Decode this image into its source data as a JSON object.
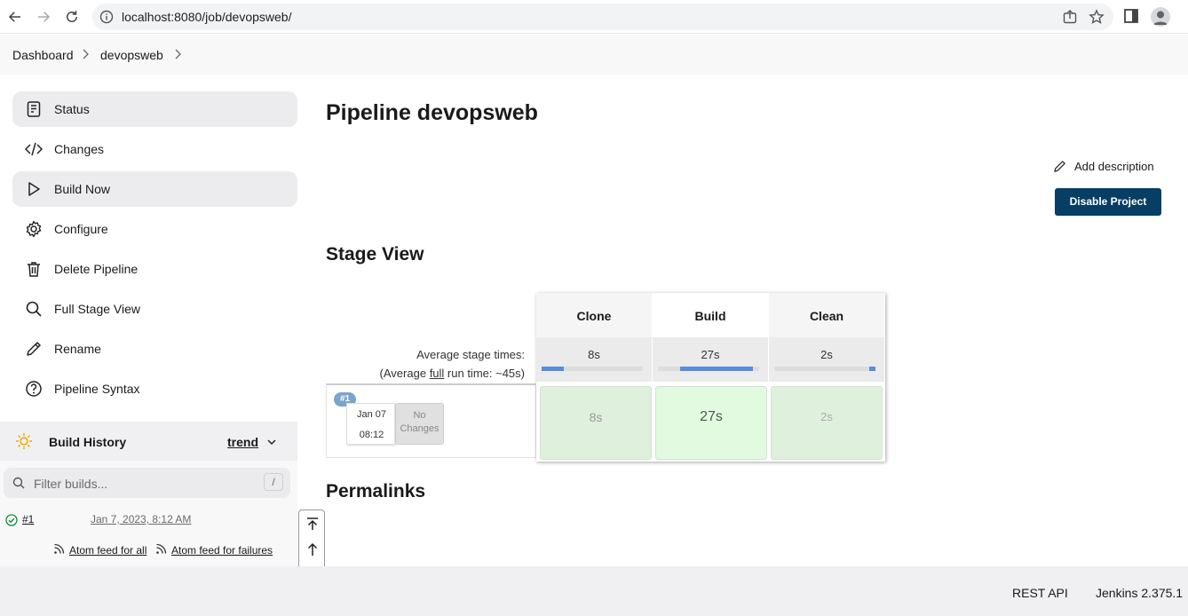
{
  "browser": {
    "url": "localhost:8080/job/devopsweb/"
  },
  "breadcrumb": {
    "items": [
      "Dashboard",
      "devopsweb"
    ]
  },
  "sidebar": {
    "items": [
      {
        "label": "Status",
        "icon": "status-icon"
      },
      {
        "label": "Changes",
        "icon": "code-icon"
      },
      {
        "label": "Build Now",
        "icon": "play-icon"
      },
      {
        "label": "Configure",
        "icon": "gear-icon"
      },
      {
        "label": "Delete Pipeline",
        "icon": "trash-icon"
      },
      {
        "label": "Full Stage View",
        "icon": "search-icon"
      },
      {
        "label": "Rename",
        "icon": "pencil-icon"
      },
      {
        "label": "Pipeline Syntax",
        "icon": "help-icon"
      }
    ]
  },
  "build_history": {
    "title": "Build History",
    "trend": "trend",
    "filter_placeholder": "Filter builds...",
    "filter_shortcut": "/",
    "builds": [
      {
        "number": "#1",
        "date": "Jan 7, 2023, 8:12 AM",
        "status": "success"
      }
    ],
    "feed_all": "Atom feed for all",
    "feed_failures": "Atom feed for failures"
  },
  "main": {
    "title": "Pipeline devopsweb",
    "add_description": "Add description",
    "disable_button": "Disable Project",
    "stage_view_title": "Stage View",
    "permalinks_title": "Permalinks"
  },
  "stage_view": {
    "avg_label": "Average stage times:",
    "avg_full_prefix": "(Average ",
    "avg_full_link": "full",
    "avg_full_suffix": " run time: ~45s)",
    "stages": [
      {
        "name": "Clone",
        "avg": "8s",
        "bar_fill": [
          0.0,
          0.22
        ],
        "run_time": "8s"
      },
      {
        "name": "Build",
        "avg": "27s",
        "bar_fill": [
          0.22,
          0.94
        ],
        "run_time": "27s"
      },
      {
        "name": "Clean",
        "avg": "2s",
        "bar_fill": [
          0.94,
          1.0
        ],
        "run_time": "2s"
      }
    ],
    "run": {
      "badge": "#1",
      "date": "Jan 07",
      "time": "08:12",
      "changes_line1": "No",
      "changes_line2": "Changes"
    }
  },
  "footer": {
    "rest_api": "REST API",
    "version": "Jenkins 2.375.1"
  },
  "colors": {
    "disable_button": "#063e64",
    "stage_success": "#dff1dd",
    "progress_fill": "#5b8dd6",
    "run_badge": "#7ba4cc"
  }
}
